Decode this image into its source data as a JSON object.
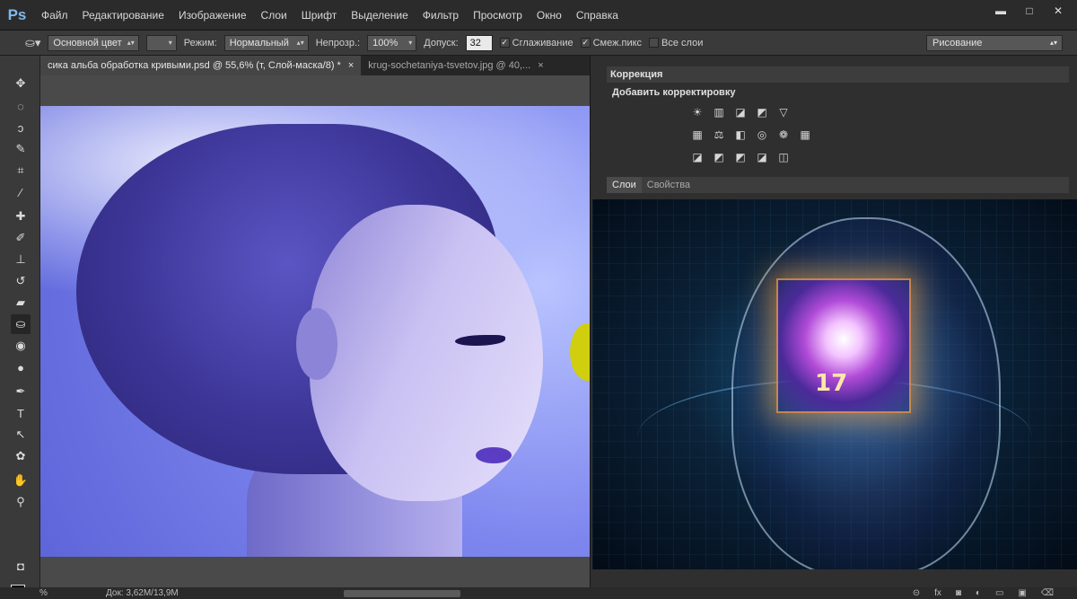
{
  "app": {
    "logo": "Ps"
  },
  "menu": [
    "Файл",
    "Редактирование",
    "Изображение",
    "Слои",
    "Шрифт",
    "Выделение",
    "Фильтр",
    "Просмотр",
    "Окно",
    "Справка"
  ],
  "window_controls": {
    "minimize": "▬",
    "maximize": "□",
    "close": "✕"
  },
  "options": {
    "source": "Основной цвет",
    "mode_label": "Режим:",
    "mode_value": "Нормальный",
    "opacity_label": "Непрозр.:",
    "opacity_value": "100%",
    "tolerance_label": "Допуск:",
    "tolerance_value": "32",
    "antialias_label": "Сглаживание",
    "antialias_checked": true,
    "contiguous_label": "Смеж.пикс",
    "contiguous_checked": true,
    "all_layers_label": "Все слои",
    "all_layers_checked": false,
    "workspace": "Рисование"
  },
  "doc_tabs": [
    {
      "label": "сика альба обработка кривыми.psd @ 55,6% (т, Слой-маска/8) *",
      "close": "×",
      "active": true
    },
    {
      "label": "krug-sochetaniya-tsvetov.jpg @ 40,...",
      "close": "×",
      "active": false
    }
  ],
  "tools": [
    "move-tool",
    "marquee-tool",
    "lasso-tool",
    "quick-selection-tool",
    "crop-tool",
    "eyedropper-tool",
    "healing-tool",
    "brush-tool",
    "stamp-tool",
    "history-brush-tool",
    "eraser-tool",
    "paint-bucket-tool",
    "blur-tool",
    "dodge-tool",
    "pen-tool",
    "type-tool",
    "path-selection-tool",
    "shape-tool",
    "hand-tool",
    "zoom-tool"
  ],
  "correction_panel": {
    "title": "Коррекция",
    "subtitle": "Добавить корректировку",
    "icons": [
      "☀",
      "▥",
      "◪",
      "◩",
      "▽",
      "▦",
      "⚖",
      "◧",
      "◎",
      "❁",
      "▦",
      "◪",
      "◩",
      "◩",
      "◪",
      "◫"
    ]
  },
  "layers_panel": {
    "tabs": [
      "Слои",
      "Свойства"
    ]
  },
  "status": {
    "zoom": "%",
    "doc": "Док: 3,62М/13,9М"
  },
  "colors": {
    "fg": "#000000",
    "bg": "#ffffff"
  }
}
